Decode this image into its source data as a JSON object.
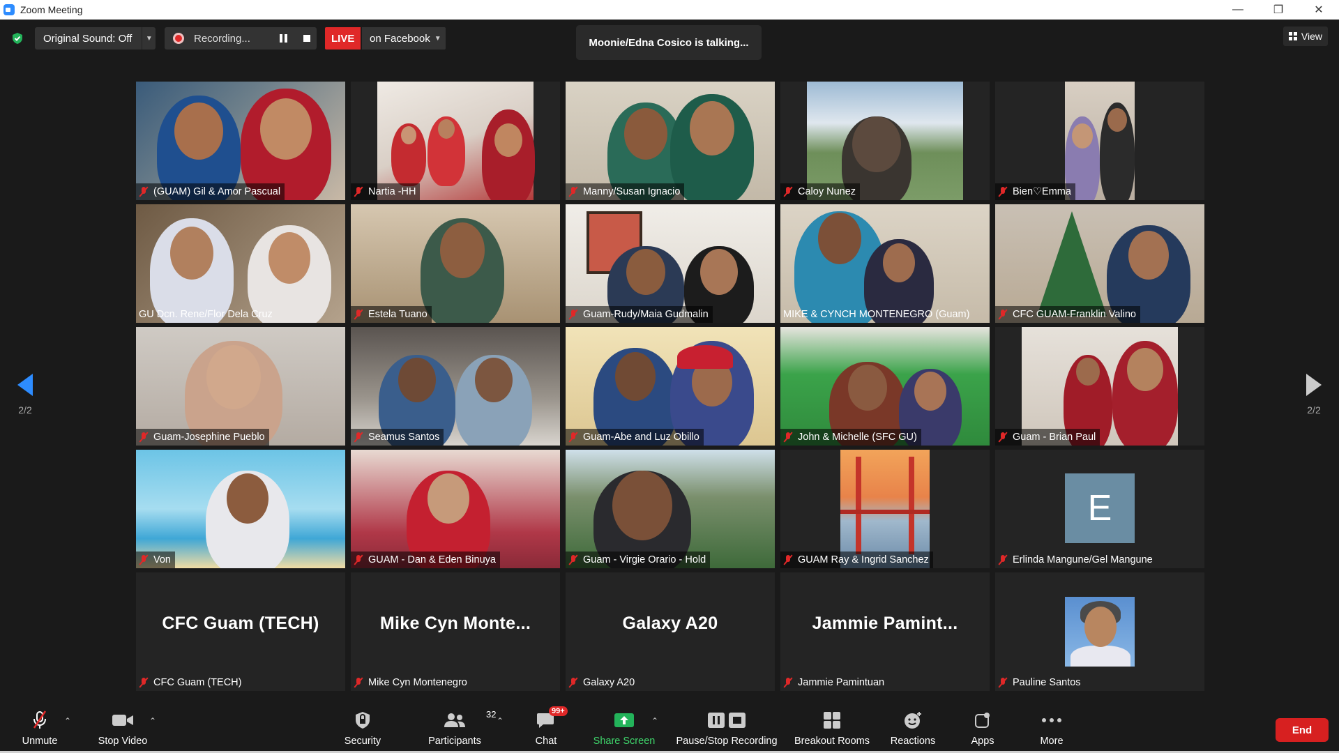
{
  "window": {
    "title": "Zoom Meeting"
  },
  "topbar": {
    "original_sound": "Original Sound: Off",
    "recording": "Recording...",
    "live": "LIVE",
    "live_destination": "on Facebook",
    "talking": "Moonie/Edna Cosico is talking...",
    "view": "View"
  },
  "paging": {
    "left": "2/2",
    "right": "2/2"
  },
  "tiles": [
    {
      "name": "(GUAM) Gil & Amor Pascual",
      "muted": true
    },
    {
      "name": "Nartia -HH",
      "muted": true
    },
    {
      "name": "Manny/Susan Ignacio",
      "muted": true
    },
    {
      "name": "Caloy Nunez",
      "muted": true
    },
    {
      "name": "Bien♡Emma",
      "muted": true
    },
    {
      "name": "GU Dcn. Rene/Flor Dela Cruz",
      "muted": false
    },
    {
      "name": "Estela Tuano",
      "muted": true
    },
    {
      "name": "Guam-Rudy/Maia Gudmalin",
      "muted": true
    },
    {
      "name": "MIKE & CYNCH MONTENEGRO (Guam)",
      "muted": false
    },
    {
      "name": "CFC GUAM-Franklin Valino",
      "muted": true
    },
    {
      "name": "Guam-Josephine Pueblo",
      "muted": true
    },
    {
      "name": "Seamus Santos",
      "muted": true
    },
    {
      "name": "Guam-Abe and Luz Obillo",
      "muted": true
    },
    {
      "name": "John & Michelle (SFC GU)",
      "muted": true
    },
    {
      "name": "Guam - Brian Paul",
      "muted": true
    },
    {
      "name": "Von",
      "muted": true
    },
    {
      "name": "GUAM - Dan & Eden Binuya",
      "muted": true
    },
    {
      "name": "Guam - Virgie Orario - Hold",
      "muted": true
    },
    {
      "name": "GUAM Ray & Ingrid Sanchez",
      "muted": true
    },
    {
      "name": "Erlinda Mangune/Gel Mangune",
      "muted": true,
      "avatar_letter": "E"
    },
    {
      "name": "CFC Guam (TECH)",
      "muted": true,
      "display_text": "CFC Guam (TECH)"
    },
    {
      "name": "Mike Cyn Montenegro",
      "muted": true,
      "display_text": "Mike Cyn Monte..."
    },
    {
      "name": "Galaxy A20",
      "muted": true,
      "display_text": "Galaxy A20"
    },
    {
      "name": "Jammie Pamintuan",
      "muted": true,
      "display_text": "Jammie Pamint..."
    },
    {
      "name": "Pauline Santos",
      "muted": true
    }
  ],
  "toolbar": {
    "unmute": "Unmute",
    "stop_video": "Stop Video",
    "security": "Security",
    "participants": "Participants",
    "participants_count": "32",
    "chat": "Chat",
    "chat_badge": "99+",
    "share_screen": "Share Screen",
    "pause_stop_recording": "Pause/Stop Recording",
    "breakout_rooms": "Breakout Rooms",
    "reactions": "Reactions",
    "apps": "Apps",
    "more": "More",
    "end": "End"
  },
  "colors": {
    "accent": "#2d8cff",
    "live": "#e02828",
    "share": "#3fd56b",
    "end": "#d72020"
  }
}
